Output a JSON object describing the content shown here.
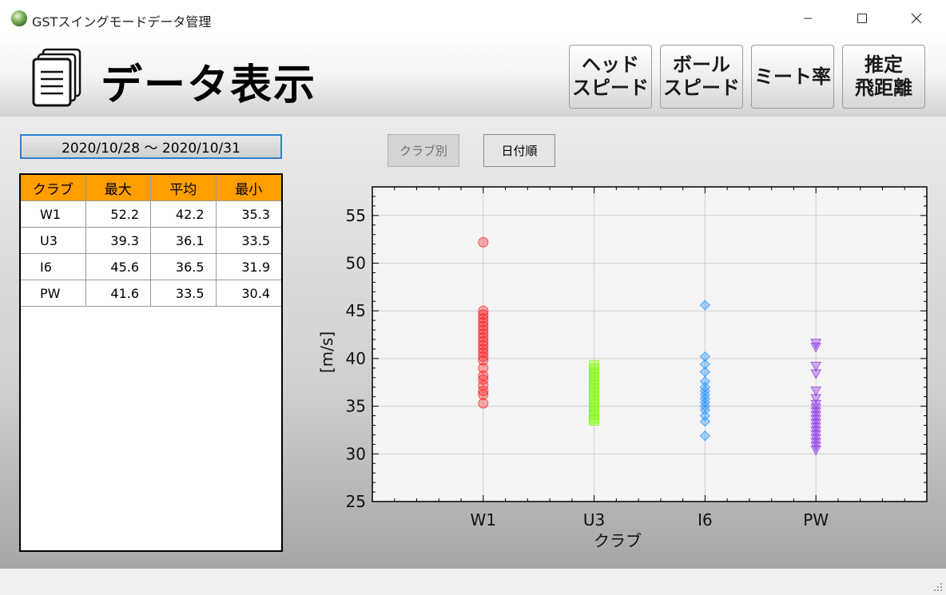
{
  "window": {
    "title": "GSTスイングモードデータ管理"
  },
  "header": {
    "title": "データ表示",
    "buttons": [
      {
        "label": "ヘッド\nスピード",
        "active": true
      },
      {
        "label": "ボール\nスピード",
        "active": false
      },
      {
        "label": "ミート率",
        "active": false
      },
      {
        "label": "推定\n飛距離",
        "active": false
      }
    ]
  },
  "date_range": "2020/10/28 ～ 2020/10/31",
  "filters": {
    "club_label": "クラブ別",
    "date_label": "日付順"
  },
  "table": {
    "headers": [
      "クラブ",
      "最大",
      "平均",
      "最小"
    ],
    "rows": [
      [
        "W1",
        "52.2",
        "42.2",
        "35.3"
      ],
      [
        "U3",
        "39.3",
        "36.1",
        "33.5"
      ],
      [
        "I6",
        "45.6",
        "36.5",
        "31.9"
      ],
      [
        "PW",
        "41.6",
        "33.5",
        "30.4"
      ]
    ]
  },
  "chart_data": {
    "type": "scatter",
    "xlabel": "クラブ",
    "ylabel": "[m/s]",
    "categories": [
      "W1",
      "U3",
      "I6",
      "PW"
    ],
    "ylim": [
      25,
      58
    ],
    "yticks": [
      25,
      30,
      35,
      40,
      45,
      50,
      55
    ],
    "grid": true,
    "series": [
      {
        "category": "W1",
        "marker": "circle",
        "color": "#ff1a1a",
        "values": [
          52.2,
          45.0,
          44.6,
          44.2,
          43.8,
          43.4,
          43.0,
          42.6,
          42.2,
          41.8,
          41.4,
          41.0,
          40.6,
          40.2,
          39.8,
          39.0,
          38.2,
          37.8,
          37.2,
          36.6,
          36.2,
          35.3
        ]
      },
      {
        "category": "U3",
        "marker": "square",
        "color": "#7cfc00",
        "values": [
          39.3,
          38.9,
          38.5,
          38.1,
          37.7,
          37.3,
          36.9,
          36.5,
          36.1,
          35.7,
          35.3,
          34.9,
          34.5,
          34.1,
          33.7,
          33.5
        ]
      },
      {
        "category": "I6",
        "marker": "diamond",
        "color": "#1e90ff",
        "values": [
          45.6,
          40.2,
          39.4,
          38.6,
          37.6,
          37.0,
          36.6,
          36.2,
          35.8,
          35.4,
          35.0,
          34.6,
          34.0,
          33.4,
          31.9
        ]
      },
      {
        "category": "PW",
        "marker": "triangle-down",
        "color": "#8a2be2",
        "values": [
          41.6,
          41.2,
          39.2,
          38.4,
          36.6,
          35.8,
          35.2,
          34.8,
          34.4,
          34.0,
          33.6,
          33.2,
          32.8,
          32.4,
          32.0,
          31.6,
          31.2,
          30.8,
          30.4
        ]
      }
    ]
  }
}
